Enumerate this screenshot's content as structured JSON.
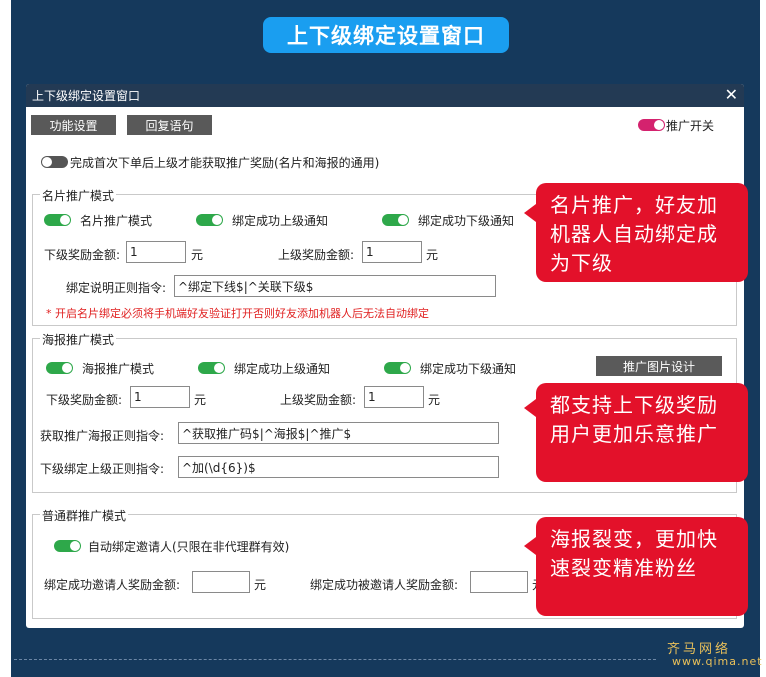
{
  "hero_title": "上下级绑定设置窗口",
  "window": {
    "title": "上下级绑定设置窗口",
    "close": "✕"
  },
  "toolbar": {
    "func_settings": "功能设置",
    "reply_text": "回复语句",
    "promo_switch": "推广开关"
  },
  "first_order_toggle": "完成首次下单后上级才能获取推广奖励(名片和海报的通用)",
  "card_section": {
    "title": "名片推广模式",
    "mode": "名片推广模式",
    "notify_upper": "绑定成功上级通知",
    "notify_lower": "绑定成功下级通知",
    "lower_reward_label": "下级奖励金额:",
    "lower_reward_value": "1",
    "upper_reward_label": "上级奖励金额:",
    "upper_reward_value": "1",
    "unit": "元",
    "regex_label": "绑定说明正则指令:",
    "regex_value": "^绑定下线$|^关联下级$",
    "warning": "* 开启名片绑定必须将手机端好友验证打开否则好友添加机器人后无法自动绑定"
  },
  "poster_section": {
    "title": "海报推广模式",
    "mode": "海报推广模式",
    "notify_upper": "绑定成功上级通知",
    "notify_lower": "绑定成功下级通知",
    "design_button": "推广图片设计",
    "lower_reward_label": "下级奖励金额:",
    "lower_reward_value": "1",
    "upper_reward_label": "上级奖励金额:",
    "upper_reward_value": "1",
    "unit": "元",
    "get_poster_label": "获取推广海报正则指令:",
    "get_poster_value": "^获取推广码$|^海报$|^推广$",
    "bind_upper_label": "下级绑定上级正则指令:",
    "bind_upper_value": "^加(\\d{6})$"
  },
  "group_section": {
    "title": "普通群推广模式",
    "auto_bind": "自动绑定邀请人(只限在非代理群有效)",
    "inviter_reward_label": "绑定成功邀请人奖励金额:",
    "inviter_unit": "元",
    "invitee_reward_label": "绑定成功被邀请人奖励金额:",
    "invitee_unit": "元"
  },
  "callouts": {
    "c1": "名片推广，好友加机器人自动绑定成为下级",
    "c2": "都支持上下级奖励用户更加乐意推广",
    "c3": "海报裂变，更加快速裂变精准粉丝"
  },
  "watermark": {
    "cn": "齐马网络",
    "url": "www.qima.net"
  },
  "colors": {
    "background": "#15395c",
    "hero": "#1a9ef0",
    "callout": "#e3112a",
    "toggle_on": "#2ea84a",
    "promo_toggle": "#d4226e"
  }
}
